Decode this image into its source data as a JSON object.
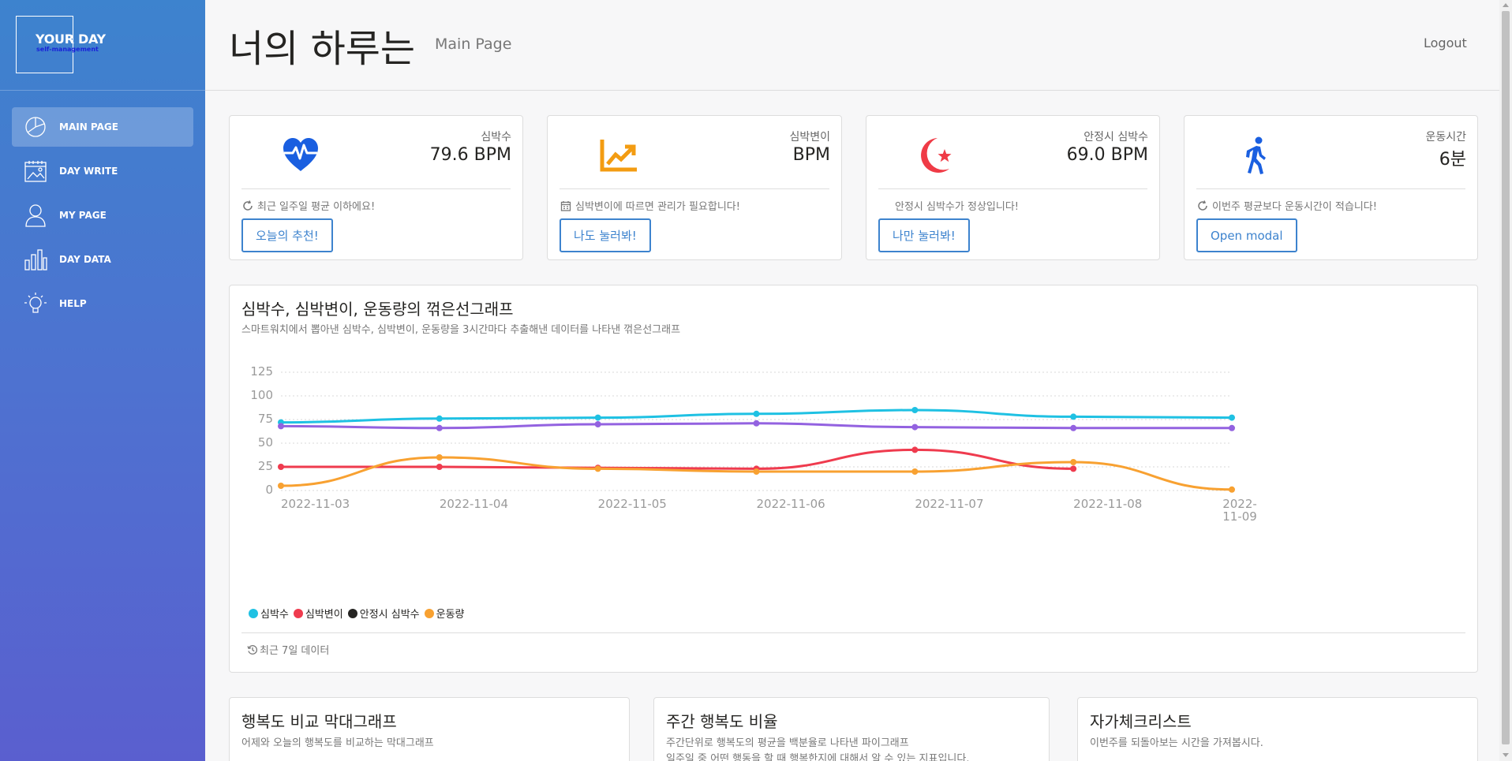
{
  "logo": {
    "title": "YOUR DAY",
    "subtitle": "self-management"
  },
  "sidebar": {
    "items": [
      {
        "label": "MAIN PAGE",
        "icon": "pie-chart-icon",
        "active": true
      },
      {
        "label": "DAY WRITE",
        "icon": "calendar-image-icon",
        "active": false
      },
      {
        "label": "MY PAGE",
        "icon": "user-icon",
        "active": false
      },
      {
        "label": "DAY DATA",
        "icon": "bar-chart-icon",
        "active": false
      },
      {
        "label": "HELP",
        "icon": "lightbulb-icon",
        "active": false
      }
    ]
  },
  "header": {
    "title": "너의 하루는",
    "subtitle": "Main Page",
    "logout": "Logout"
  },
  "stats": [
    {
      "label": "심박수",
      "value": "79.6 BPM",
      "icon": "heart-pulse-icon",
      "icon_color": "#1a5fe0",
      "footer_icon": "refresh-icon",
      "footer": "최근 일주일 평균 이하에요!",
      "button": "오늘의 추천!"
    },
    {
      "label": "심박변이",
      "value": "BPM",
      "icon": "trending-up-icon",
      "icon_color": "#f39c12",
      "footer_icon": "calendar-icon",
      "footer": "심박변이에 따르면 관리가 필요합니다!",
      "button": "나도 눌러봐!"
    },
    {
      "label": "안정시 심박수",
      "value": "69.0 BPM",
      "icon": "crescent-star-icon",
      "icon_color": "#ef3b46",
      "footer_icon": "",
      "footer": "안정시 심박수가 정상입니다!",
      "button": "나만 눌러봐!"
    },
    {
      "label": "운동시간",
      "value": "6분",
      "icon": "walking-person-icon",
      "icon_color": "#1a5fe0",
      "footer_icon": "refresh-icon",
      "footer": "이번주 평균보다 운동시간이 적습니다!",
      "button": "Open modal"
    }
  ],
  "line_chart": {
    "title": "심박수, 심박변이, 운동량의 꺾은선그래프",
    "subtitle": "스마트워치에서 뽑아낸 심박수, 심박변이, 운동량을 3시간마다 추출해낸 데이터를 나타낸 꺾은선그래프",
    "footer": "최근 7일 데이터"
  },
  "chart_data": {
    "type": "line",
    "x": [
      "2022-11-03",
      "2022-11-04",
      "2022-11-05",
      "2022-11-06",
      "2022-11-07",
      "2022-11-08",
      "2022-11-09"
    ],
    "yticks": [
      0,
      25,
      50,
      75,
      100,
      125
    ],
    "ylim": [
      0,
      125
    ],
    "grid": true,
    "legend_position": "bottom-left",
    "series": [
      {
        "name": "심박수",
        "color": "#1fc1e3",
        "values": [
          72,
          76,
          77,
          81,
          85,
          78,
          77
        ]
      },
      {
        "name": "심박변이",
        "color": "#ef3b4e",
        "values": [
          25,
          25,
          24,
          23,
          43,
          23,
          null
        ]
      },
      {
        "name": "안정시 심박수",
        "color": "#9362e0",
        "values": [
          68,
          66,
          70,
          71,
          67,
          66,
          66
        ]
      },
      {
        "name": "운동량",
        "color": "#f8a131",
        "values": [
          5,
          35,
          23,
          20,
          20,
          30,
          1
        ]
      }
    ],
    "legend": [
      {
        "name": "심박수",
        "color": "#1fc1e3"
      },
      {
        "name": "심박변이",
        "color": "#ef3b4e"
      },
      {
        "name": "안정시 심박수",
        "color": "#252422"
      },
      {
        "name": "운동량",
        "color": "#f8a131"
      }
    ]
  },
  "bottom_cards": [
    {
      "title": "행복도 비교 막대그래프",
      "subtitle": "어제와 오늘의 행복도를 비교하는 막대그래프",
      "subtitle2": ""
    },
    {
      "title": "주간 행복도 비율",
      "subtitle": "주간단위로 행복도의 평균을 백분율로 나타낸 파이그래프",
      "subtitle2": "일주일 중 어떤 행동을 할 때 행복한지에 대해서 알 수 있는 지표입니다."
    },
    {
      "title": "자가체크리스트",
      "subtitle": "이번주를 되돌아보는 시간을 가져봅시다.",
      "subtitle2": ""
    }
  ]
}
